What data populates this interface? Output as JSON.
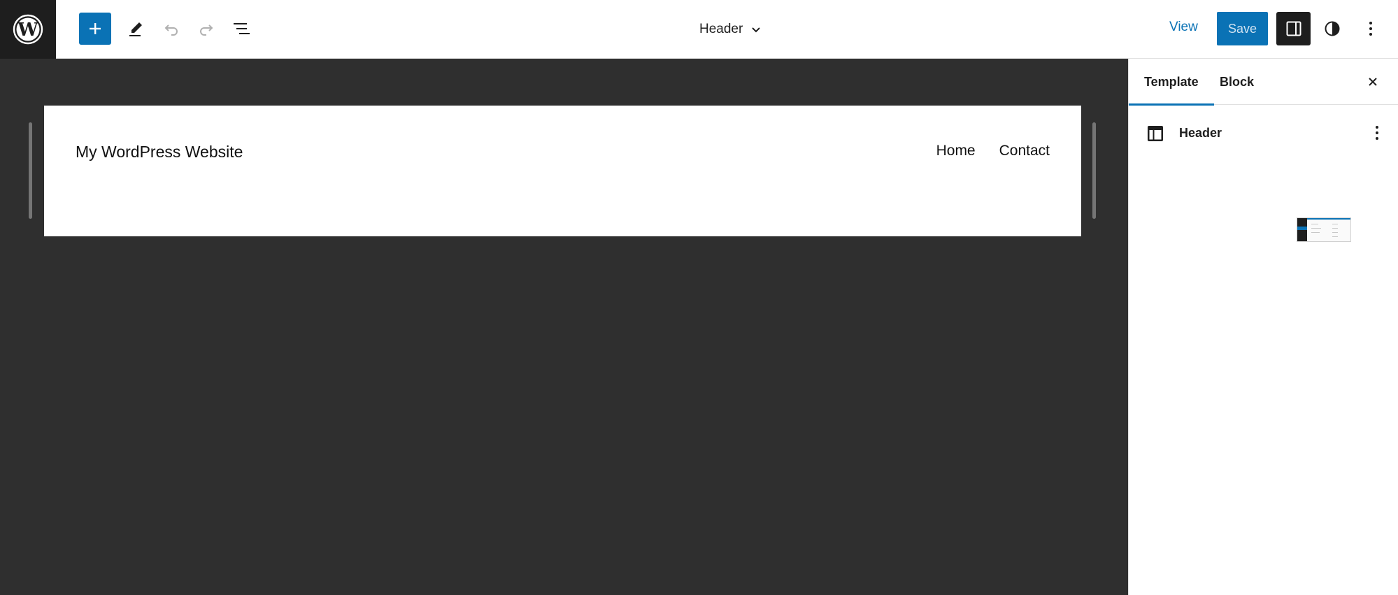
{
  "toolbar": {
    "add_label": "+",
    "document_title": "Header",
    "view_label": "View",
    "save_label": "Save"
  },
  "canvas": {
    "site_title": "My WordPress Website",
    "nav_items": [
      "Home",
      "Contact"
    ]
  },
  "sidebar": {
    "tabs": [
      "Template",
      "Block"
    ],
    "active_tab": "Template",
    "template_name": "Header"
  },
  "colors": {
    "accent": "#0a72b5",
    "dark": "#1e1e1e",
    "canvas_bg": "#2f2f2f"
  },
  "icons": {
    "logo": "wordpress-icon",
    "add": "plus-icon",
    "tools": "pencil-icon",
    "undo": "undo-icon",
    "redo": "redo-icon",
    "list_view": "list-view-icon",
    "chevron": "chevron-down-icon",
    "settings": "sidebar-panel-icon",
    "styles": "half-circle-icon",
    "options": "vertical-ellipsis-icon",
    "close": "close-icon",
    "layout": "layout-icon"
  }
}
